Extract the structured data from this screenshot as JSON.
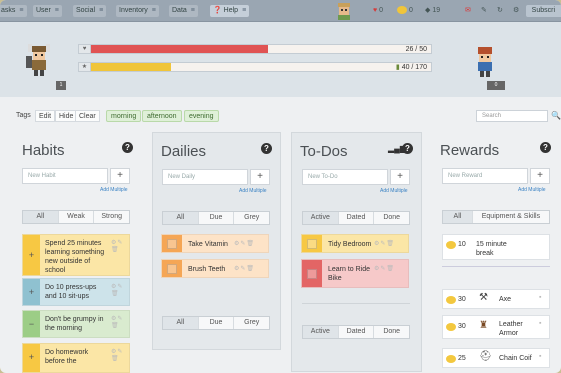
{
  "nav": {
    "items": [
      "asks",
      "User",
      "Social",
      "Inventory",
      "Data"
    ],
    "help": "Help",
    "subscribe": "Subscri"
  },
  "header_stats": {
    "hp": "0",
    "gold": "0",
    "gems": "19"
  },
  "hero": {
    "hp": {
      "text": "26 / 50",
      "fraction": 0.52,
      "color": "#e05353"
    },
    "xp": {
      "text": "40 / 170",
      "fraction": 0.235,
      "color": "#f0c53a"
    },
    "level_badge": "1",
    "party_badge": "0"
  },
  "filters": {
    "buttons": [
      "Tags",
      "Edit",
      "Hide",
      "Clear"
    ],
    "tags": [
      "morning",
      "afternoon",
      "evening"
    ],
    "search_placeholder": "Search"
  },
  "columns": {
    "habits": {
      "title": "Habits",
      "placeholder": "New Habit",
      "add_multiple": "Add Multiple",
      "tabs": [
        "All",
        "Weak",
        "Strong"
      ],
      "tasks": [
        {
          "text": "Spend 25 minutes learning something new outside of school",
          "sign": "+",
          "color": "#fbe6a6",
          "ctrl": "#f7c843"
        },
        {
          "text": "Do 10 press-ups and 10 sit-ups",
          "sign": "+",
          "color": "#cde3ea",
          "ctrl": "#8fc1d0"
        },
        {
          "text": "Don't be grumpy in the morning",
          "sign": "−",
          "color": "#d9ebcf",
          "ctrl": "#9ccd86"
        },
        {
          "text": "Do homework before the",
          "sign": "+",
          "color": "#fbe6a6",
          "ctrl": "#f7c843"
        }
      ]
    },
    "dailies": {
      "title": "Dailies",
      "placeholder": "New Daily",
      "add_multiple": "Add Multiple",
      "tabs": [
        "All",
        "Due",
        "Grey"
      ],
      "tasks": [
        {
          "text": "Take Vitamin",
          "color": "#fde3c7",
          "ctrl": "#f5a655"
        },
        {
          "text": "Brush Teeth",
          "color": "#fde3c7",
          "ctrl": "#f5a655"
        }
      ],
      "bottom_tabs": [
        "All",
        "Due",
        "Grey"
      ]
    },
    "todos": {
      "title": "To-Dos",
      "placeholder": "New To-Do",
      "add_multiple": "Add Multiple",
      "tabs": [
        "Active",
        "Dated",
        "Done"
      ],
      "tasks": [
        {
          "text": "Tidy Bedroom",
          "color": "#fbe6a6",
          "ctrl": "#f7c843"
        },
        {
          "text": "Learn to Ride Bike",
          "color": "#f6c9c9",
          "ctrl": "#e36565"
        }
      ],
      "bottom_tabs": [
        "Active",
        "Dated",
        "Done"
      ]
    },
    "rewards": {
      "title": "Rewards",
      "placeholder": "New Reward",
      "add_multiple": "Add Multiple",
      "tabs": [
        "All",
        "Equipment & Skills"
      ],
      "custom": [
        {
          "value": "10",
          "name": "15 minute break"
        }
      ],
      "items": [
        {
          "value": "30",
          "name": "Axe"
        },
        {
          "value": "30",
          "name": "Leather Armor"
        },
        {
          "value": "25",
          "name": "Chain Coif"
        }
      ]
    }
  }
}
